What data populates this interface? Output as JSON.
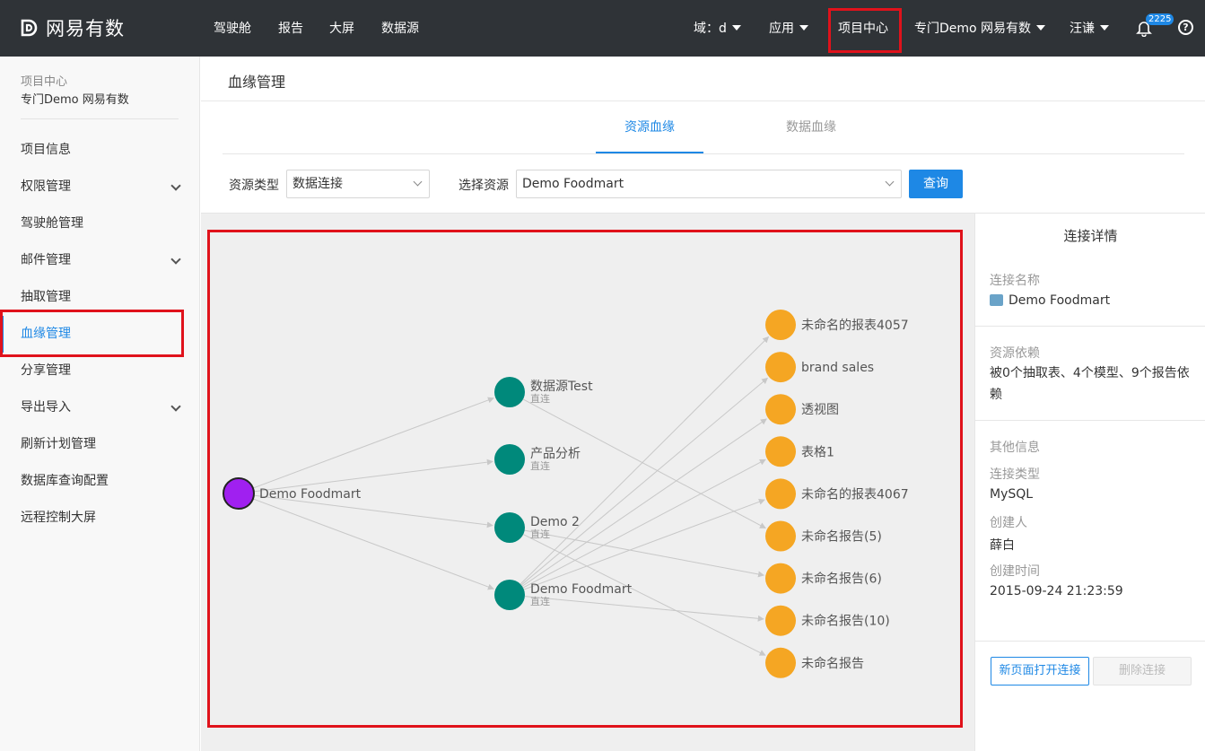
{
  "topbar": {
    "logo_text": "网易有数",
    "nav": [
      "驾驶舱",
      "报告",
      "大屏",
      "数据源"
    ],
    "domain": "域：d",
    "apps": "应用",
    "project_center": "项目中心",
    "project": "专门Demo 网易有数",
    "user": "汪谦",
    "notification_count": "2225",
    "help": "?"
  },
  "sidebar": {
    "section_label": "项目中心",
    "project_name": "专门Demo 网易有数",
    "items": [
      {
        "label": "项目信息",
        "expandable": false
      },
      {
        "label": "权限管理",
        "expandable": true
      },
      {
        "label": "驾驶舱管理",
        "expandable": false
      },
      {
        "label": "邮件管理",
        "expandable": true
      },
      {
        "label": "抽取管理",
        "expandable": false
      },
      {
        "label": "血缘管理",
        "expandable": false,
        "active": true
      },
      {
        "label": "分享管理",
        "expandable": false
      },
      {
        "label": "导出导入",
        "expandable": true
      },
      {
        "label": "刷新计划管理",
        "expandable": false
      },
      {
        "label": "数据库查询配置",
        "expandable": false
      },
      {
        "label": "远程控制大屏",
        "expandable": false
      }
    ]
  },
  "main": {
    "page_title": "血缘管理",
    "tabs": [
      "资源血缘",
      "数据血缘"
    ],
    "active_tab": 0,
    "filters": {
      "resource_type_label": "资源类型",
      "resource_type_value": "数据连接",
      "select_resource_label": "选择资源",
      "select_resource_value": "Demo Foodmart",
      "query_button": "查询"
    }
  },
  "graph": {
    "colors": {
      "root": "#a020f0",
      "middle": "#00897b",
      "leaf": "#f5a623",
      "edge": "#c8c8c8"
    },
    "root": {
      "id": "root",
      "label": "Demo Foodmart"
    },
    "middle": [
      {
        "id": "m0",
        "label": "数据源Test",
        "sub": "直连"
      },
      {
        "id": "m1",
        "label": "产品分析",
        "sub": "直连"
      },
      {
        "id": "m2",
        "label": "Demo 2",
        "sub": "直连"
      },
      {
        "id": "m3",
        "label": "Demo Foodmart",
        "sub": "直连"
      }
    ],
    "leaves": [
      {
        "id": "l0",
        "label": "未命名的报表4057"
      },
      {
        "id": "l1",
        "label": "brand sales"
      },
      {
        "id": "l2",
        "label": "透视图"
      },
      {
        "id": "l3",
        "label": "表格1"
      },
      {
        "id": "l4",
        "label": "未命名的报表4067"
      },
      {
        "id": "l5",
        "label": "未命名报告(5)"
      },
      {
        "id": "l6",
        "label": "未命名报告(6)"
      },
      {
        "id": "l7",
        "label": "未命名报告(10)"
      },
      {
        "id": "l8",
        "label": "未命名报告"
      }
    ],
    "edges": [
      [
        "root",
        "m0"
      ],
      [
        "root",
        "m1"
      ],
      [
        "root",
        "m2"
      ],
      [
        "root",
        "m3"
      ],
      [
        "m0",
        "l5"
      ],
      [
        "m2",
        "l6"
      ],
      [
        "m2",
        "l8"
      ],
      [
        "m3",
        "l0"
      ],
      [
        "m3",
        "l1"
      ],
      [
        "m3",
        "l2"
      ],
      [
        "m3",
        "l3"
      ],
      [
        "m3",
        "l4"
      ],
      [
        "m3",
        "l7"
      ]
    ]
  },
  "details": {
    "title": "连接详情",
    "conn_name_label": "连接名称",
    "conn_name": "Demo Foodmart",
    "dependency_label": "资源依赖",
    "dependency_text": "被0个抽取表、4个模型、9个报告依赖",
    "other_label": "其他信息",
    "conn_type_label": "连接类型",
    "conn_type": "MySQL",
    "creator_label": "创建人",
    "creator": "薛白",
    "created_label": "创建时间",
    "created": "2015-09-24 21:23:59",
    "open_button": "新页面打开连接",
    "delete_button": "删除连接"
  }
}
